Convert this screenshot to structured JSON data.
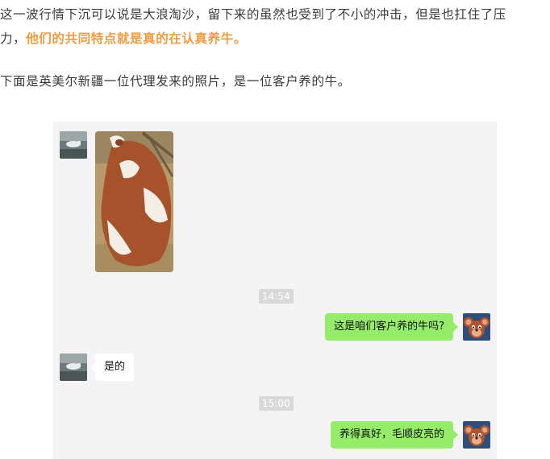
{
  "article": {
    "p1_line1": "这一波行情下沉可以说是大浪淘沙，留下来的虽然也受到了不小的冲击，但是也扛住了压",
    "p1_line2_start": "力，",
    "p1_highlight": "他们的共同特点就是真的在认真养牛。",
    "p2": "下面是英美尔新疆一位代理发来的照片，是一位客户养的牛。"
  },
  "chat": {
    "messages": [
      {
        "sender": "other",
        "type": "image",
        "content": "cow-photo"
      },
      {
        "type": "time",
        "text": "14:54"
      },
      {
        "sender": "me",
        "type": "text",
        "text": "这是咱们客户养的牛吗?"
      },
      {
        "sender": "other",
        "type": "text",
        "text": "是的"
      },
      {
        "type": "time",
        "text": "15:00"
      },
      {
        "sender": "me",
        "type": "text",
        "text": "养得真好，毛顺皮亮的"
      }
    ]
  },
  "colors": {
    "highlight": "#f29b3f",
    "chat_background": "#f4f4f4",
    "my_bubble": "#95ec69",
    "other_bubble": "#ffffff",
    "time_badge": "#d9d9d9"
  },
  "icons": {
    "agent_avatar": "cow-photo-avatar",
    "user_avatar": "cartoon-mouse-avatar"
  }
}
